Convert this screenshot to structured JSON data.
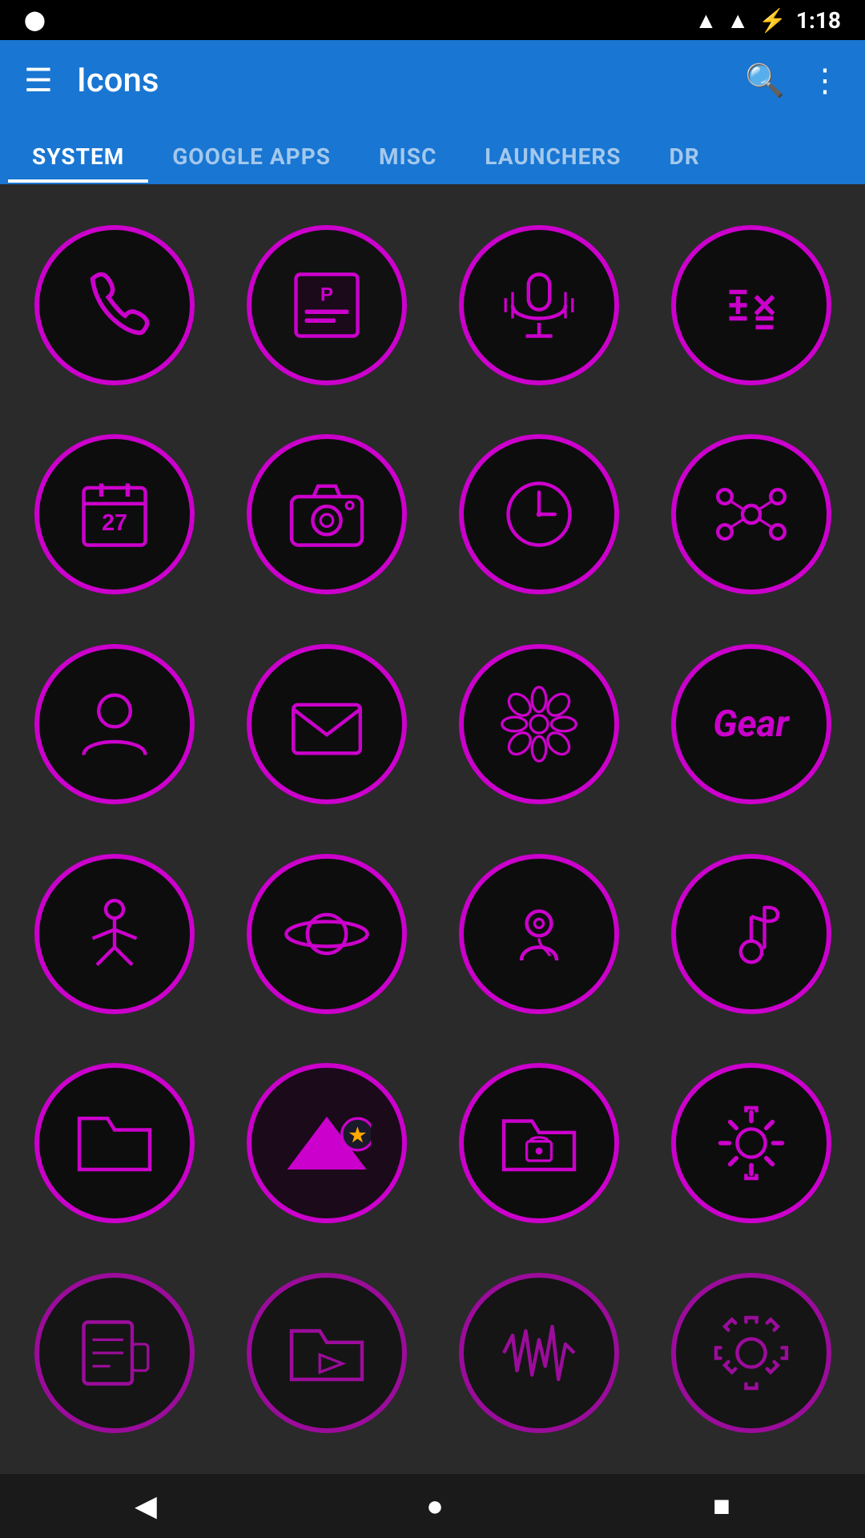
{
  "status_bar": {
    "time": "1:18",
    "battery_icon": "🔋",
    "signal_icon": "📶",
    "wifi_icon": "📡"
  },
  "app_bar": {
    "menu_label": "☰",
    "title": "Icons",
    "search_label": "🔍",
    "more_label": "⋮"
  },
  "tabs": [
    {
      "id": "system",
      "label": "SYSTEM",
      "active": true
    },
    {
      "id": "google-apps",
      "label": "GOOGLE APPS",
      "active": false
    },
    {
      "id": "misc",
      "label": "MISC",
      "active": false
    },
    {
      "id": "launchers",
      "label": "LAUNCHERS",
      "active": false
    },
    {
      "id": "dr",
      "label": "DR",
      "active": false
    }
  ],
  "icons": [
    {
      "id": "phone",
      "name": "phone-icon",
      "type": "phone"
    },
    {
      "id": "poster",
      "name": "poster-icon",
      "type": "poster"
    },
    {
      "id": "microphone",
      "name": "microphone-icon",
      "type": "microphone"
    },
    {
      "id": "calculator",
      "name": "calculator-icon",
      "type": "calculator"
    },
    {
      "id": "calendar",
      "name": "calendar-icon",
      "type": "calendar"
    },
    {
      "id": "camera",
      "name": "camera-icon",
      "type": "camera"
    },
    {
      "id": "clock",
      "name": "clock-icon",
      "type": "clock"
    },
    {
      "id": "nodes",
      "name": "nodes-icon",
      "type": "nodes"
    },
    {
      "id": "contacts",
      "name": "contacts-icon",
      "type": "contacts"
    },
    {
      "id": "email",
      "name": "email-icon",
      "type": "email"
    },
    {
      "id": "flower",
      "name": "flower-icon",
      "type": "flower"
    },
    {
      "id": "gear-text",
      "name": "gear-text-icon",
      "type": "gear-text"
    },
    {
      "id": "fitness",
      "name": "fitness-icon",
      "type": "fitness"
    },
    {
      "id": "planet",
      "name": "planet-icon",
      "type": "planet"
    },
    {
      "id": "health",
      "name": "health-icon",
      "type": "health"
    },
    {
      "id": "music",
      "name": "music-icon",
      "type": "music"
    },
    {
      "id": "folder",
      "name": "folder-icon",
      "type": "folder"
    },
    {
      "id": "bookmark",
      "name": "bookmark-icon",
      "type": "bookmark"
    },
    {
      "id": "secure-folder",
      "name": "secure-folder-icon",
      "type": "secure-folder"
    },
    {
      "id": "settings",
      "name": "settings-icon",
      "type": "settings"
    },
    {
      "id": "paint",
      "name": "paint-icon",
      "type": "paint"
    },
    {
      "id": "video-folder",
      "name": "video-folder-icon",
      "type": "video-folder"
    },
    {
      "id": "waveform",
      "name": "waveform-icon",
      "type": "waveform"
    },
    {
      "id": "gear-bottom",
      "name": "gear-bottom-icon",
      "type": "gear-bottom"
    }
  ],
  "nav_bar": {
    "back_label": "◀",
    "home_label": "●",
    "recent_label": "■"
  }
}
